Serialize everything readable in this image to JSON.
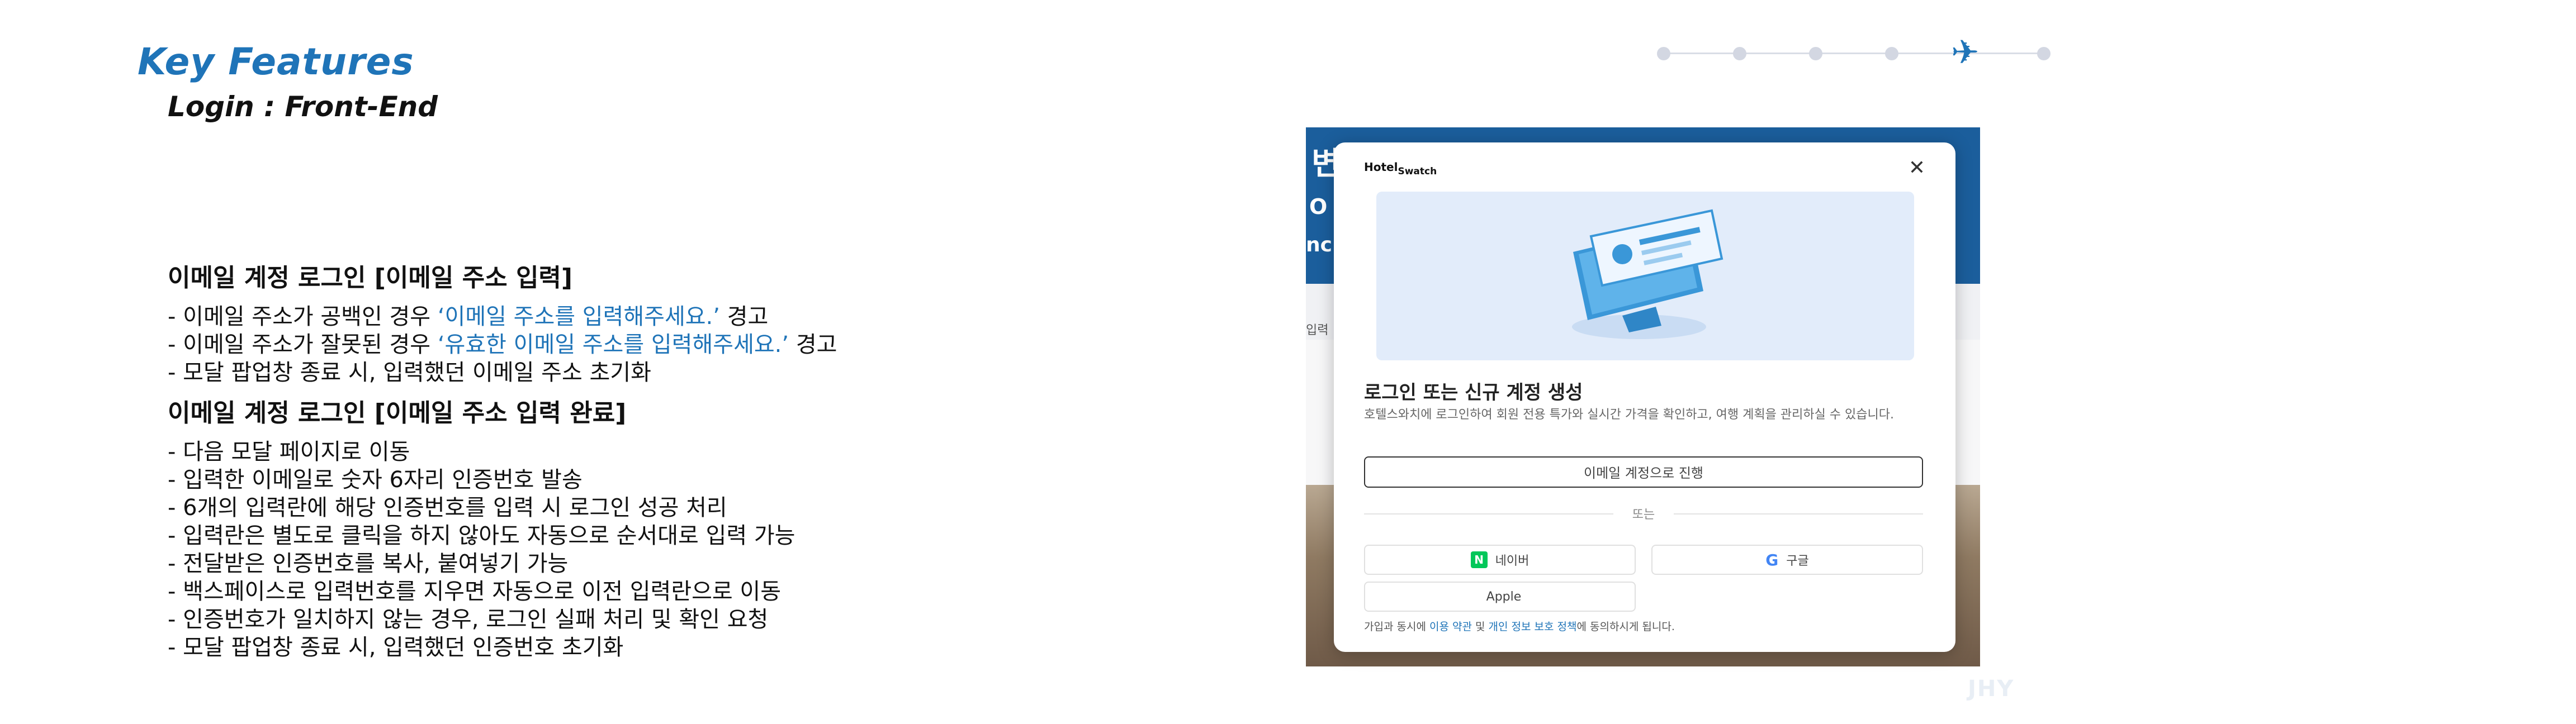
{
  "header": {
    "title": "Key Features",
    "subtitle": "Login : Front-End"
  },
  "progress": {
    "steps": 6,
    "current_step_index": 4,
    "current_icon": "airplane-icon"
  },
  "sections": [
    {
      "heading": "이메일 계정 로그인 [이메일 주소 입력]",
      "items": [
        {
          "prefix": "- 이메일 주소가 공백인 경우 ",
          "highlight": "‘이메일 주소를 입력해주세요.’",
          "suffix": " 경고"
        },
        {
          "prefix": "- 이메일 주소가 잘못된 경우 ",
          "highlight": "‘유효한 이메일 주소를 입력해주세요.’",
          "suffix": " 경고"
        },
        {
          "prefix": "- 모달 팝업창 종료 시, 입력했던 이메일 주소 초기화",
          "highlight": "",
          "suffix": ""
        }
      ]
    },
    {
      "heading": "이메일 계정 로그인 [이메일 주소 입력 완료]",
      "items": [
        "- 다음 모달 페이지로 이동",
        "- 입력한 이메일로 숫자 6자리 인증번호 발송",
        "- 6개의 입력란에 해당 인증번호를 입력 시 로그인 성공 처리",
        "- 입력란은 별도로 클릭을 하지 않아도 자동으로 순서대로 입력 가능",
        "- 전달받은 인증번호를 복사, 붙여넣기 가능",
        "- 백스페이스로 입력번호를 지우면 자동으로 이전 입력란으로 이동",
        "- 인증번호가 일치하지 않는 경우, 로그인 실패 처리 및 확인 요청",
        "- 모달 팝업창 종료 시, 입력했던 인증번호 초기화"
      ]
    }
  ],
  "screenshot": {
    "bg_fragments": [
      "변",
      "O",
      "nc",
      "입력"
    ],
    "modal": {
      "brand_top": "Hotel",
      "brand_bottom": "Swatch",
      "close_glyph": "✕",
      "heading": "로그인 또는 신규 계정 생성",
      "description": "호텔스와치에 로그인하여 회원 전용 특가와 실시간 가격을 확인하고, 여행 계획을 관리하실 수 있습니다.",
      "email_button": "이메일 계정으로 진행",
      "divider_text": "또는",
      "social": {
        "naver": {
          "logo": "N",
          "label": "네이버"
        },
        "google": {
          "logo": "G",
          "label": "구글"
        },
        "apple": {
          "logo": "",
          "label": "Apple"
        }
      },
      "terms": {
        "prefix": "가입과 동시에 ",
        "link1": "이용 약관",
        "middle": " 및 ",
        "link2": "개인 정보 보호 정책",
        "suffix": "에 동의하시게 됩니다."
      }
    }
  },
  "watermark": "JHY",
  "colors": {
    "accent": "#1f74b8",
    "naver": "#03c75a",
    "header_blue": "#1b5e9c"
  }
}
